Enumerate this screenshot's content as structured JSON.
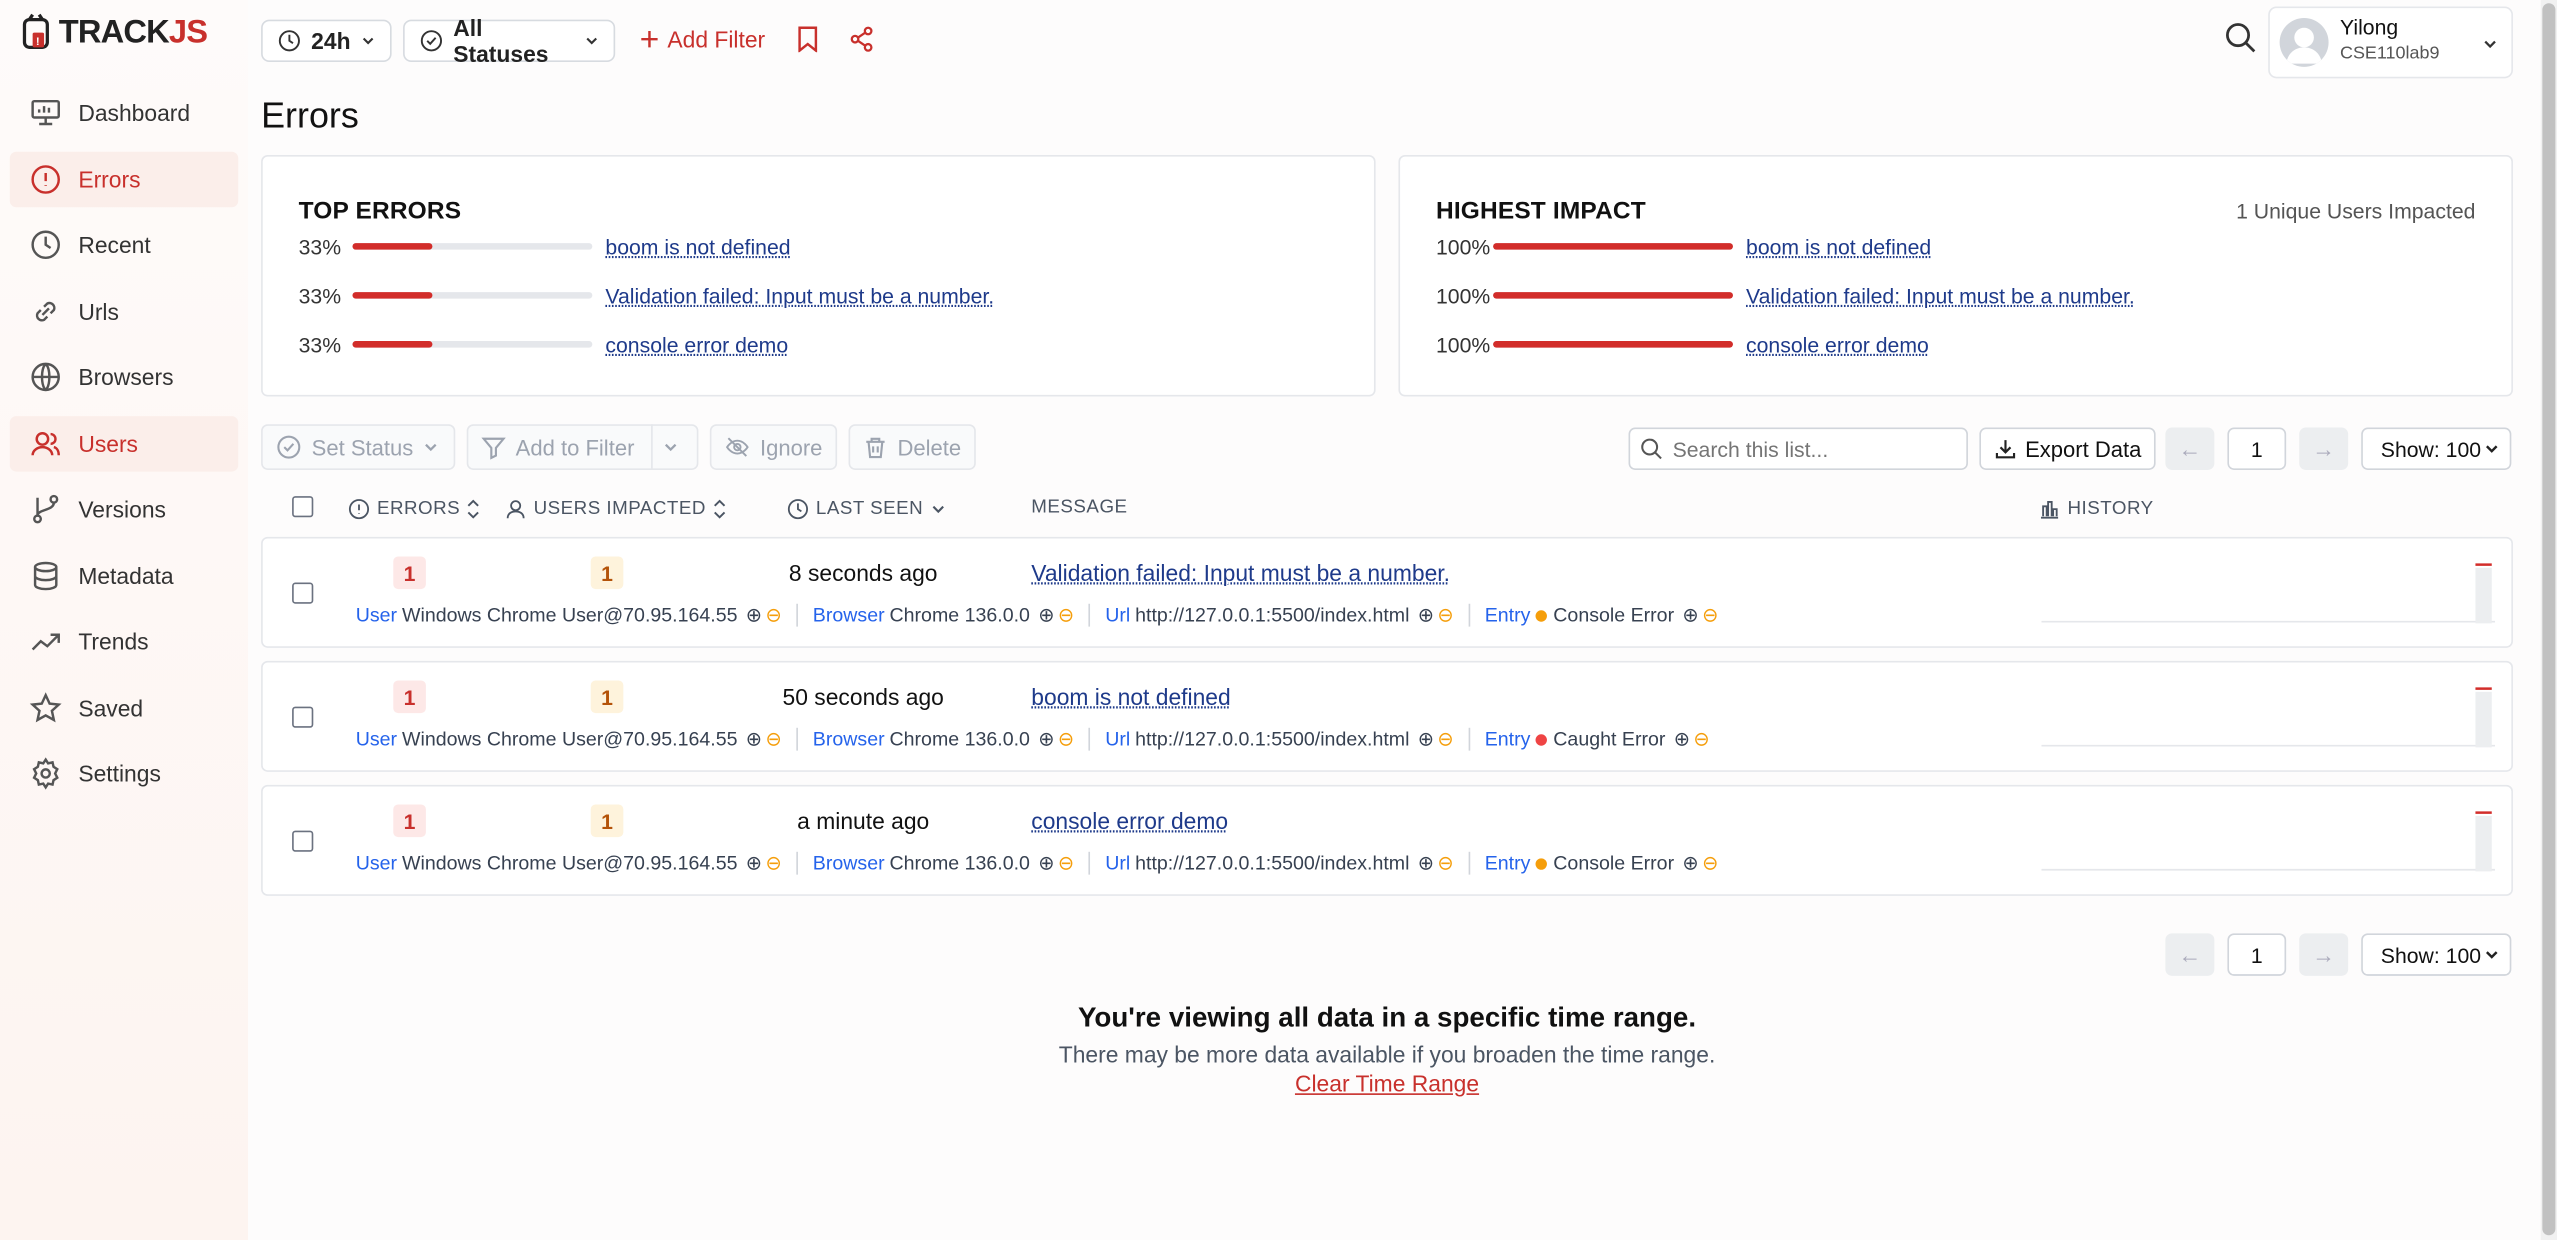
{
  "app": {
    "logo_text_main": "TRACK",
    "logo_text_accent": "JS",
    "brand_color": "#c8302c"
  },
  "sidebar": {
    "items": [
      {
        "label": "Dashboard",
        "icon": "presentation-icon"
      },
      {
        "label": "Errors",
        "icon": "alert-circle-icon",
        "active": true
      },
      {
        "label": "Recent",
        "icon": "clock-icon"
      },
      {
        "label": "Urls",
        "icon": "link-icon"
      },
      {
        "label": "Browsers",
        "icon": "globe-icon"
      },
      {
        "label": "Users",
        "icon": "users-icon",
        "active": true
      },
      {
        "label": "Versions",
        "icon": "git-branch-icon"
      },
      {
        "label": "Metadata",
        "icon": "database-icon"
      },
      {
        "label": "Trends",
        "icon": "trending-up-icon"
      },
      {
        "label": "Saved",
        "icon": "star-icon"
      },
      {
        "label": "Settings",
        "icon": "gear-icon"
      }
    ]
  },
  "topbar": {
    "time_range": "24h",
    "status_filter": "All Statuses",
    "add_filter": "Add Filter",
    "user_name": "Yilong",
    "user_org": "CSE110lab9"
  },
  "page": {
    "title": "Errors"
  },
  "top_errors": {
    "title": "TOP ERRORS",
    "rows": [
      {
        "pct_label": "33%",
        "pct": 0.33,
        "message": "boom is not defined"
      },
      {
        "pct_label": "33%",
        "pct": 0.33,
        "message": "Validation failed: Input must be a number."
      },
      {
        "pct_label": "33%",
        "pct": 0.33,
        "message": "console error demo"
      }
    ]
  },
  "highest_impact": {
    "title": "HIGHEST IMPACT",
    "subtitle": "1 Unique Users Impacted",
    "rows": [
      {
        "pct_label": "100%",
        "pct": 1.0,
        "message": "boom is not defined"
      },
      {
        "pct_label": "100%",
        "pct": 1.0,
        "message": "Validation failed: Input must be a number."
      },
      {
        "pct_label": "100%",
        "pct": 1.0,
        "message": "console error demo"
      }
    ]
  },
  "toolbar": {
    "set_status": "Set Status",
    "add_to_filter": "Add to Filter",
    "ignore": "Ignore",
    "delete": "Delete",
    "search_placeholder": "Search this list...",
    "export": "Export Data",
    "page": "1",
    "show": "Show: 100"
  },
  "table": {
    "headers": {
      "errors": "ERRORS",
      "users": "USERS IMPACTED",
      "last_seen": "LAST SEEN",
      "message": "MESSAGE",
      "history": "HISTORY"
    },
    "rows": [
      {
        "errors": "1",
        "users": "1",
        "last_seen": "8 seconds ago",
        "message": "Validation failed: Input must be a number.",
        "user_key": "User",
        "user_val": "Windows Chrome User@70.95.164.55",
        "browser_key": "Browser",
        "browser_val": "Chrome 136.0.0",
        "url_key": "Url",
        "url_val": "http://127.0.0.1:5500/index.html",
        "entry_key": "Entry",
        "entry_val": "Console Error",
        "entry_color": "#f59e0b"
      },
      {
        "errors": "1",
        "users": "1",
        "last_seen": "50 seconds ago",
        "message": "boom is not defined",
        "user_key": "User",
        "user_val": "Windows Chrome User@70.95.164.55",
        "browser_key": "Browser",
        "browser_val": "Chrome 136.0.0",
        "url_key": "Url",
        "url_val": "http://127.0.0.1:5500/index.html",
        "entry_key": "Entry",
        "entry_val": "Caught Error",
        "entry_color": "#ef4444"
      },
      {
        "errors": "1",
        "users": "1",
        "last_seen": "a minute ago",
        "message": "console error demo",
        "user_key": "User",
        "user_val": "Windows Chrome User@70.95.164.55",
        "browser_key": "Browser",
        "browser_val": "Chrome 136.0.0",
        "url_key": "Url",
        "url_val": "http://127.0.0.1:5500/index.html",
        "entry_key": "Entry",
        "entry_val": "Console Error",
        "entry_color": "#f59e0b"
      }
    ]
  },
  "footer": {
    "page": "1",
    "show": "Show: 100",
    "notice_title": "You're viewing all data in a specific time range.",
    "notice_text": "There may be more data available if you broaden the time range.",
    "clear_link": "Clear Time Range"
  }
}
